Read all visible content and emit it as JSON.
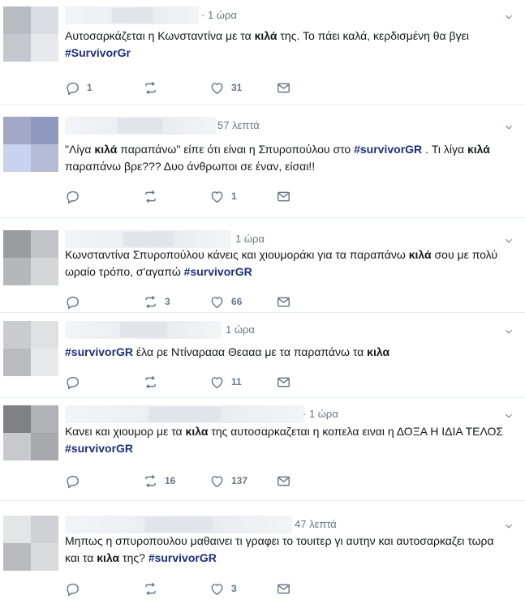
{
  "tweets": [
    {
      "time": "· 1 ώρα",
      "text_parts": [
        {
          "t": "Αυτοσαρκάζεται η Κωνσταντίνα με τα ",
          "k": "plain"
        },
        {
          "t": "κιλά",
          "k": "bold"
        },
        {
          "t": " της. Το πάει καλά, κερδισμένη θα βγει ",
          "k": "plain"
        },
        {
          "t": "#SurvivorGr",
          "k": "tag"
        }
      ],
      "replies": "1",
      "retweets": "",
      "likes": "31",
      "avatar_colors": [
        "#b7bcc3",
        "#d9dde2",
        "#c4c8ce",
        "#e6e8eb"
      ]
    },
    {
      "time": "57 λεπτά",
      "text_parts": [
        {
          "t": "\"Λίγα ",
          "k": "plain"
        },
        {
          "t": "κιλά",
          "k": "bold"
        },
        {
          "t": " παραπάνω\" είπε ότι είναι η Σπυροπούλου στο ",
          "k": "plain"
        },
        {
          "t": "#survivorGR",
          "k": "tag"
        },
        {
          "t": " . Τι λίγα ",
          "k": "plain"
        },
        {
          "t": "κιλά",
          "k": "bold"
        },
        {
          "t": " παραπάνω βρε??? Δυο άνθρωποι σε έναν, είσαι!!",
          "k": "plain"
        }
      ],
      "replies": "",
      "retweets": "",
      "likes": "1",
      "avatar_colors": [
        "#a3a8c9",
        "#8f98be",
        "#c9d2ee",
        "#b7bcd6"
      ]
    },
    {
      "time": "1 ώρα",
      "text_parts": [
        {
          "t": "Κωνσταντίνα Σπυροπούλου κάνεις και χιουμοράκι για τα παραπάνω ",
          "k": "plain"
        },
        {
          "t": "κιλά",
          "k": "bold"
        },
        {
          "t": " σου με πολύ ωραίο τρόπο, σ'αγαπώ  ",
          "k": "plain"
        },
        {
          "t": "#survivorGR",
          "k": "tag"
        }
      ],
      "replies": "",
      "retweets": "3",
      "likes": "66",
      "avatar_colors": [
        "#9a9c9f",
        "#c1c3c6",
        "#b5b7ba",
        "#d4d6d8"
      ]
    },
    {
      "time": "1 ώρα",
      "text_parts": [
        {
          "t": "#survivorGR",
          "k": "tag"
        },
        {
          "t": " έλα ρε Ντίναρααα Θεααα με τα παραπάνω τα ",
          "k": "plain"
        },
        {
          "t": "κιλα",
          "k": "bold"
        }
      ],
      "replies": "",
      "retweets": "",
      "likes": "11",
      "avatar_colors": [
        "#c9cbce",
        "#dfe1e3",
        "#b9bbbe",
        "#e8e9ea"
      ]
    },
    {
      "time": "· 1 ώρα",
      "text_parts": [
        {
          "t": "Κανει και χιουμορ με τα ",
          "k": "plain"
        },
        {
          "t": "κιλα",
          "k": "bold"
        },
        {
          "t": " της αυτοσαρκαζεται η κοπελα ειναι η ΔΟΞΑ Η ΙΔΙΑ ΤΕΛΟΣ  ",
          "k": "plain"
        },
        {
          "t": "#survivorGR",
          "k": "tag"
        }
      ],
      "replies": "",
      "retweets": "16",
      "likes": "137",
      "avatar_colors": [
        "#7f8184",
        "#b0b2b5",
        "#c7c9cc",
        "#a6a8ab"
      ]
    },
    {
      "time": "47 λεπτά",
      "text_parts": [
        {
          "t": "Μηπως η σπυροπουλου μαθαινει τι γραφει το τουιτερ γι αυτην και αυτοσαρκαζει τωρα και τα ",
          "k": "plain"
        },
        {
          "t": "κιλα",
          "k": "bold"
        },
        {
          "t": " της?  ",
          "k": "plain"
        },
        {
          "t": "#survivorGR",
          "k": "tag"
        }
      ],
      "replies": "",
      "retweets": "",
      "likes": "3",
      "avatar_colors": [
        "#e3e5e7",
        "#cfd1d4",
        "#b8babd",
        "#d9dbdd"
      ]
    }
  ]
}
